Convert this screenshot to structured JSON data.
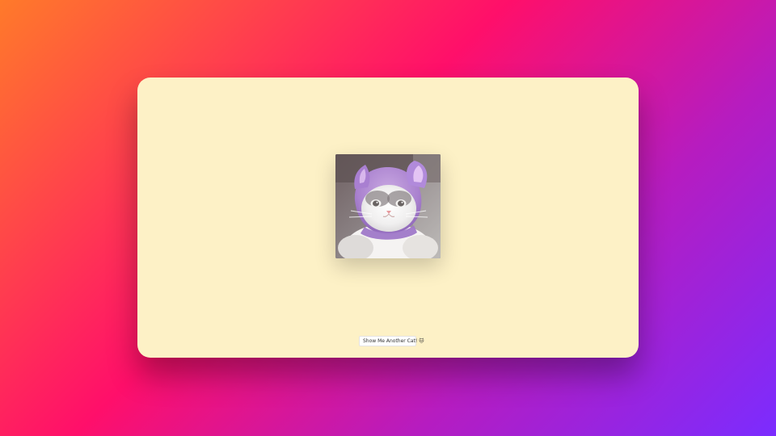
{
  "button": {
    "label": "Show Me Another Cat! 🐱"
  },
  "colors": {
    "background_start": "#ff7a2a",
    "background_mid": "#ff0f6a",
    "background_end": "#7b2cff",
    "card": "#fdf1c6"
  },
  "image": {
    "name": "cat-photo-icon"
  }
}
